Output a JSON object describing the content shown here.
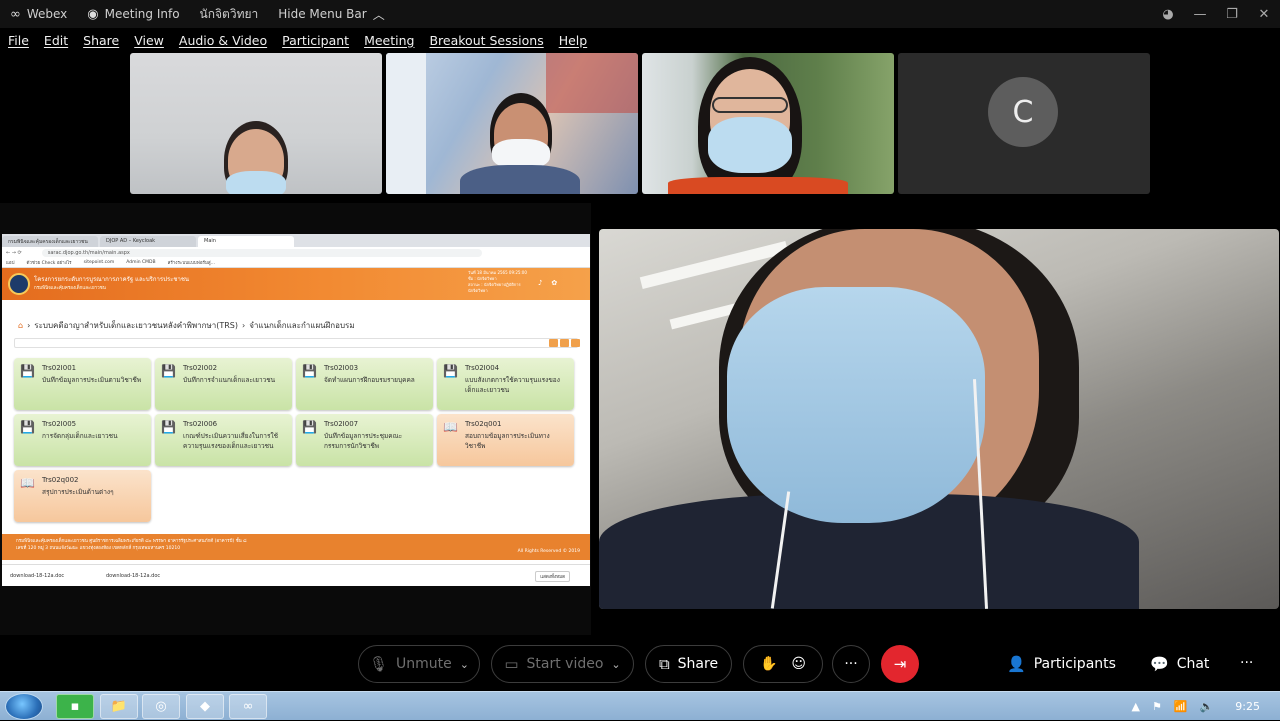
{
  "titlebar": {
    "app": "Webex",
    "meeting_info": "Meeting Info",
    "user": "นักจิตวิทยา",
    "hide_menu": "Hide Menu Bar"
  },
  "menu": [
    "File",
    "Edit",
    "Share",
    "View",
    "Audio & Video",
    "Participant",
    "Meeting",
    "Breakout Sessions",
    "Help"
  ],
  "tiles": {
    "avatar_letter": "C"
  },
  "shared": {
    "tabs": [
      "กรมพินิจและคุ้มครองเด็กและเยาวชน",
      "DJOP AD – Keycloak",
      "Main"
    ],
    "url": "sarac.djop.go.th/main/main.aspx",
    "bookmarks": [
      "แอป",
      "ตัวช่วย Check อย่างไร",
      "sitepoint.com",
      "Admin CMDB",
      "สร้างระบบแบบฟอร์มสู่..."
    ],
    "site_title": "โครงการยกระดับการบูรณาการภาครัฐ และบริการประชาชน",
    "site_sub": "กรมพินิจและคุ้มครองเด็กและเยาวชน",
    "site_user": [
      "วันที่ 18 มีนาคม 2565 09:25:00",
      "ชื่อ : นักจิตวิทยา",
      "สถานะ : นักจิตวิทยาปฏิบัติการ",
      "นักจิตวิทยา"
    ],
    "breadcrumb_1": "ระบบคดีอาญาสำหรับเด็กและเยาวชนหลังคำพิพากษา(TRS)",
    "breadcrumb_2": "จำแนกเด็กและกำแผนฝึกอบรม",
    "cards": [
      {
        "code": "Trs02I001",
        "name": "บันทึกข้อมูลการประเมินตามวิชาชีพ",
        "kind": "green"
      },
      {
        "code": "Trs02I002",
        "name": "บันทึกการจำแนกเด็กและเยาวชน",
        "kind": "green"
      },
      {
        "code": "Trs02I003",
        "name": "จัดทำแผนการฝึกอบรมรายบุคคล",
        "kind": "green"
      },
      {
        "code": "Trs02I004",
        "name": "แบบสังเกตการใช้ความรุนแรงของเด็กและเยาวชน",
        "kind": "green"
      },
      {
        "code": "Trs02I005",
        "name": "การจัดกลุ่มเด็กและเยาวชน",
        "kind": "green"
      },
      {
        "code": "Trs02I006",
        "name": "เกณฑ์ประเมินความเสี่ยงในการใช้ความรุนแรงของเด็กและเยาวชน",
        "kind": "green"
      },
      {
        "code": "Trs02I007",
        "name": "บันทึกข้อมูลการประชุมคณะกรรมการนักวิชาชีพ",
        "kind": "green"
      },
      {
        "code": "Trs02q001",
        "name": "สอบถามข้อมูลการประเมินทางวิชาชีพ",
        "kind": "orange"
      },
      {
        "code": "Trs02q002",
        "name": "สรุปการประเมินด้านต่างๆ",
        "kind": "orange"
      }
    ],
    "footer_line1": "กรมพินิจและคุ้มครองเด็กและเยาวชน ศูนย์ราชการเฉลิมพระเกียรติ ๘๐ พรรษา อาคารรัฐประศาสนภักดี (อาคารบี) ชั้น ๘",
    "footer_line2": "เลขที่ 120 หมู่ 3 ถนนแจ้งวัฒนะ แขวงทุ่งสองห้อง เขตหลักสี่ กรุงเทพมหานคร 10210",
    "footer_rights": "All Rights Reserved © 2019",
    "downloads": [
      "download-18-12a.doc",
      "download-18-12a.doc"
    ],
    "show_all": "แสดงทั้งหมด"
  },
  "controls": {
    "unmute": "Unmute",
    "start_video": "Start video",
    "share": "Share",
    "participants": "Participants",
    "chat": "Chat"
  },
  "taskbar": {
    "time": "9:25"
  },
  "colors": {
    "end_call": "#e3262e",
    "site_orange": "#e8822e",
    "card_green": "#c9e3a6",
    "card_orange": "#f6c79c"
  }
}
